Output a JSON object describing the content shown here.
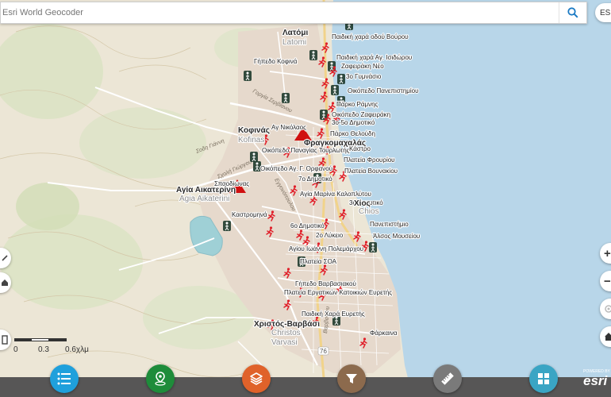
{
  "search": {
    "placeholder": "Esri World Geocoder"
  },
  "topright": {
    "label": "ESI"
  },
  "map": {
    "labels": [
      {
        "text": "Λατόμι",
        "cls": "town"
      },
      {
        "text": "Latomi",
        "cls": "townlat"
      },
      {
        "text": "Παιδική χαρά οδού Βούρου",
        "cls": "poi"
      },
      {
        "text": "Παιδική χαρά Αγ. Ισιδώρου",
        "cls": "poi"
      },
      {
        "text": "Ζαφειράκη Νέο",
        "cls": "poi"
      },
      {
        "text": "Γήπεδο Κοφινά",
        "cls": "poi"
      },
      {
        "text": "3ο Γυμνάσιο",
        "cls": "poi"
      },
      {
        "text": "Οικόπεδο Πανεπιστημίου",
        "cls": "poi"
      },
      {
        "text": "Πάρκο Ράμνης",
        "cls": "poi"
      },
      {
        "text": "Οικόπεδο Ζαφειράκη",
        "cls": "poi"
      },
      {
        "text": "3ο-5ο Δημοτικό",
        "cls": "poi"
      },
      {
        "text": "Αγ Νικόλαος",
        "cls": "poi"
      },
      {
        "text": "Κοφινάς",
        "cls": "town"
      },
      {
        "text": "Kofinas",
        "cls": "townlat"
      },
      {
        "text": "Πάρκο Θελούδη",
        "cls": "poi"
      },
      {
        "text": "Φραγκομαχαλάς",
        "cls": "town"
      },
      {
        "text": "Οικόπεδο Παναγίας Τουρλωτής",
        "cls": "poi"
      },
      {
        "text": "Κάστρο",
        "cls": "poi"
      },
      {
        "text": "Πλατεία Φρουρίου",
        "cls": "poi"
      },
      {
        "text": "Οικόπεδο Αγ. Γ. Ορφανού",
        "cls": "poi"
      },
      {
        "text": "Πλατεία Βουνακίου",
        "cls": "poi"
      },
      {
        "text": "Σπαρδίωνας",
        "cls": "poi"
      },
      {
        "text": "7ο Δημοτικό",
        "cls": "poi"
      },
      {
        "text": "Αγία Αικατερίνη",
        "cls": "town"
      },
      {
        "text": "Agia Aikaterini",
        "cls": "townlat"
      },
      {
        "text": "Αγία Μαρίνα Καλοπλύτου",
        "cls": "poi"
      },
      {
        "text": "3ο Δημοτικό",
        "cls": "poi"
      },
      {
        "text": "Χίος",
        "cls": "town"
      },
      {
        "text": "Chios",
        "cls": "townlat"
      },
      {
        "text": "Καστρομηνά",
        "cls": "poi"
      },
      {
        "text": "6ο Δημοτικό",
        "cls": "poi"
      },
      {
        "text": "Πανεπιστήμιο",
        "cls": "poi"
      },
      {
        "text": "2ο Λύκειο",
        "cls": "poi"
      },
      {
        "text": "Άλσος Μουσείου",
        "cls": "poi"
      },
      {
        "text": "Αγίου Ιωάννη Πολεμάρχου",
        "cls": "poi"
      },
      {
        "text": "Πλατεία ΣΟΑ",
        "cls": "poi"
      },
      {
        "text": "Γήπεδο Βαρβασιακού",
        "cls": "poi"
      },
      {
        "text": "Πλατεία Εργατικών Κατοικιών Ευρετής",
        "cls": "poi"
      },
      {
        "text": "Παιδική Χαρά Ευρετής",
        "cls": "poi"
      },
      {
        "text": "Χριστός-Βαρβάσι",
        "cls": "town"
      },
      {
        "text": "Christos",
        "cls": "townlat"
      },
      {
        "text": "Varvasi",
        "cls": "townlat"
      },
      {
        "text": "Φάρκαινα",
        "cls": "poi"
      },
      {
        "text": "Γοργία Σερβίανου",
        "cls": "street"
      },
      {
        "text": "Σοδη Γιάννη",
        "cls": "street"
      },
      {
        "text": "Σχολή Γιώργου",
        "cls": "street"
      },
      {
        "text": "Εγγονόπουλου",
        "cls": "street"
      },
      {
        "text": "Βαρβασίου",
        "cls": "street"
      },
      {
        "text": "76",
        "cls": "shield"
      }
    ]
  },
  "scale": {
    "labels": [
      "0",
      "0.3",
      "0.6χλμ"
    ]
  },
  "tools": [
    {
      "name": "layer-list",
      "color": "#1fa0dc"
    },
    {
      "name": "location",
      "color": "#1e8c3a"
    },
    {
      "name": "layers",
      "color": "#e0622a"
    },
    {
      "name": "filter",
      "color": "#8c6a4d"
    },
    {
      "name": "measure",
      "color": "#7a7a7a"
    },
    {
      "name": "apps",
      "color": "#3aa5c4"
    }
  ],
  "zoom": {
    "in": "+",
    "out": "−"
  },
  "branding": {
    "powered": "POWERED BY",
    "esri": "esri"
  },
  "colors": {
    "water": "#b7d6e8",
    "land": "#ece6d6",
    "urban": "#e4d7ca",
    "hill": "#d7e2c0",
    "road": "#ffffff",
    "major_road": "#f4d790",
    "runner": "#e0202a",
    "triangle": "#d01010",
    "hiker": "#222222"
  }
}
